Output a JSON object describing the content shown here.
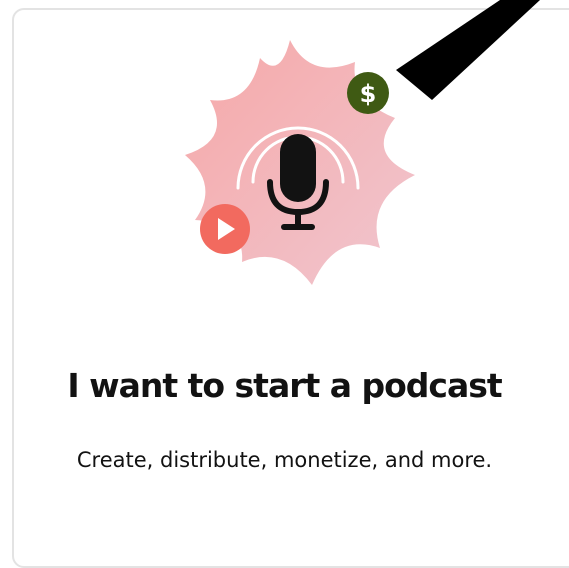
{
  "card": {
    "title": "I want to start a podcast",
    "subtitle": "Create, distribute, monetize, and more."
  },
  "illustration": {
    "icons": [
      "microphone-icon",
      "play-icon",
      "dollar-icon"
    ],
    "dollar_symbol": "$",
    "colors": {
      "burst": "#f4b3b3",
      "play": "#f26a5f",
      "dollar": "#3f5a13",
      "mic": "#121212"
    }
  }
}
